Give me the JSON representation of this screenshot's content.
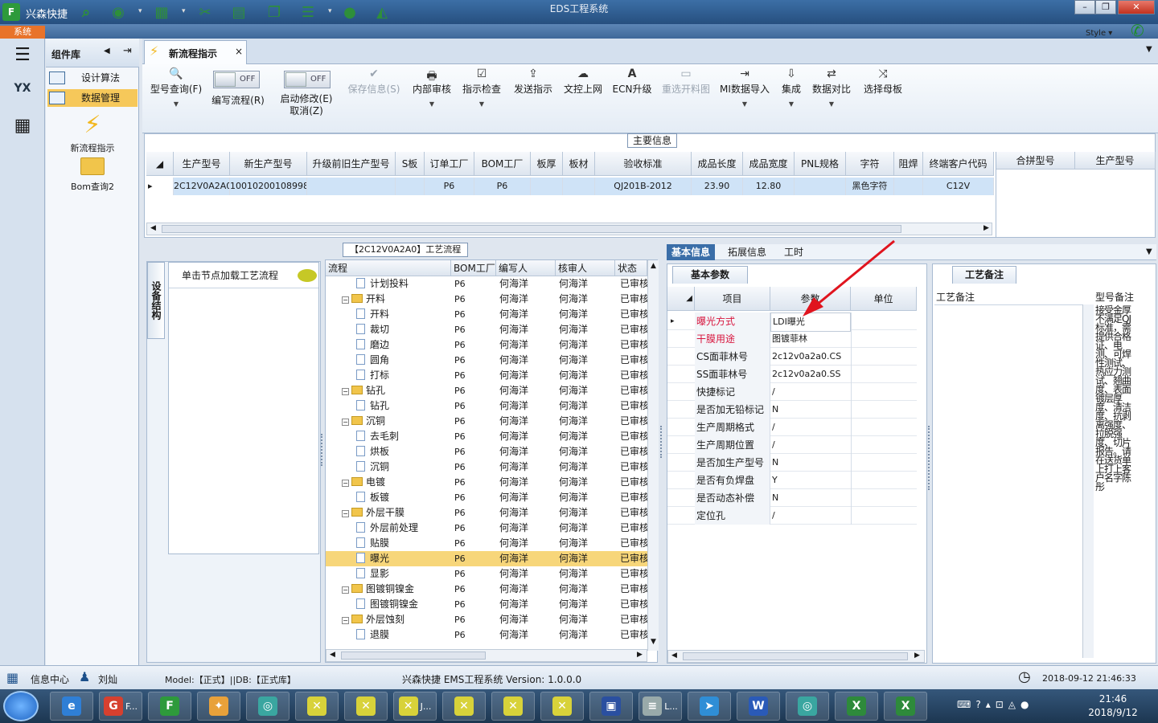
{
  "window": {
    "app_name": "兴森快捷",
    "title": "EDS工程系统",
    "style_label": "Style ▾",
    "system_tab": "系统",
    "controls": [
      "–",
      "❐",
      "✕"
    ]
  },
  "toolbar_icons": [
    "search-icon",
    "compass-icon",
    "grid-icon",
    "scissors-icon",
    "film-icon",
    "clipboard-icon",
    "list-icon",
    "user-icon",
    "mountain-chart-icon"
  ],
  "left_strip": {
    "items": [
      "menu-icon",
      "factory-icon",
      "calculator-icon"
    ]
  },
  "component_library": {
    "title": "组件库",
    "items": [
      {
        "label": "设计算法"
      },
      {
        "label": "数据管理",
        "selected": true
      }
    ],
    "tools": [
      {
        "label": "新流程指示"
      },
      {
        "label": "Bom查询2"
      }
    ]
  },
  "tabs": [
    {
      "label": "新流程指示",
      "close": "×"
    }
  ],
  "ribbon": {
    "buttons": [
      {
        "label": "型号查询(F)",
        "icon": "🔍",
        "disabled": false,
        "dropdown": true
      },
      {
        "label": "编写流程(R)",
        "toggle": "OFF"
      },
      {
        "label": "启动修改(E)",
        "label2": "取消(Z)",
        "toggle": "OFF"
      },
      {
        "label": "保存信息(S)",
        "icon": "✔",
        "disabled": true
      },
      {
        "label": "内部审核",
        "icon": "🖶",
        "dropdown": true
      },
      {
        "label": "指示检查",
        "icon": "☑",
        "dropdown": true
      },
      {
        "label": "发送指示",
        "icon": "⇪"
      },
      {
        "label": "文控上网",
        "icon": "☁"
      },
      {
        "label": "ECN升级",
        "icon": "A"
      },
      {
        "label": "重选开料图",
        "icon": "▭",
        "disabled": true
      },
      {
        "label": "MI数据导入",
        "icon": "⇥",
        "dropdown": true
      },
      {
        "label": "集成",
        "icon": "⇩",
        "dropdown": true
      },
      {
        "label": "数据对比",
        "icon": "⇄",
        "dropdown": true
      },
      {
        "label": "选择母板",
        "icon": "⤨"
      }
    ]
  },
  "main_info": {
    "label": "主要信息",
    "columns": [
      "生产型号",
      "新生产型号",
      "升级前旧生产型号",
      "S板",
      "订单工厂",
      "BOM工厂",
      "板厚",
      "板材",
      "验收标准",
      "成品长度",
      "成品宽度",
      "PNL规格",
      "字符",
      "阻焊",
      "终端客户代码"
    ],
    "row": [
      "2C12V0A2A0",
      "10010200108998",
      "",
      "",
      "P6",
      "P6",
      "",
      "",
      "QJ201B-2012",
      "23.90",
      "12.80",
      "",
      "黑色字符",
      "",
      "C12V"
    ],
    "side_columns": [
      "合拼型号",
      "生产型号"
    ]
  },
  "equipment": {
    "vtab": "设备结构",
    "hint": "单击节点加载工艺流程"
  },
  "flow": {
    "title": "【2C12V0A2A0】工艺流程",
    "columns": [
      "流程",
      "BOM工厂",
      "编写人",
      "核审人",
      "状态"
    ],
    "rows": [
      {
        "name": "计划投料",
        "level": 1,
        "factory": "P6",
        "writer": "何海洋",
        "reviewer": "何海洋",
        "status": "已审核"
      },
      {
        "name": "开料",
        "level": 0,
        "factory": "P6",
        "writer": "何海洋",
        "reviewer": "何海洋",
        "status": "已审核"
      },
      {
        "name": "开料",
        "level": 1,
        "factory": "P6",
        "writer": "何海洋",
        "reviewer": "何海洋",
        "status": "已审核"
      },
      {
        "name": "裁切",
        "level": 1,
        "factory": "P6",
        "writer": "何海洋",
        "reviewer": "何海洋",
        "status": "已审核"
      },
      {
        "name": "磨边",
        "level": 1,
        "factory": "P6",
        "writer": "何海洋",
        "reviewer": "何海洋",
        "status": "已审核"
      },
      {
        "name": "圆角",
        "level": 1,
        "factory": "P6",
        "writer": "何海洋",
        "reviewer": "何海洋",
        "status": "已审核"
      },
      {
        "name": "打标",
        "level": 1,
        "factory": "P6",
        "writer": "何海洋",
        "reviewer": "何海洋",
        "status": "已审核"
      },
      {
        "name": "钻孔",
        "level": 0,
        "factory": "P6",
        "writer": "何海洋",
        "reviewer": "何海洋",
        "status": "已审核"
      },
      {
        "name": "钻孔",
        "level": 1,
        "factory": "P6",
        "writer": "何海洋",
        "reviewer": "何海洋",
        "status": "已审核"
      },
      {
        "name": "沉铜",
        "level": 0,
        "factory": "P6",
        "writer": "何海洋",
        "reviewer": "何海洋",
        "status": "已审核"
      },
      {
        "name": "去毛刺",
        "level": 1,
        "factory": "P6",
        "writer": "何海洋",
        "reviewer": "何海洋",
        "status": "已审核"
      },
      {
        "name": "烘板",
        "level": 1,
        "factory": "P6",
        "writer": "何海洋",
        "reviewer": "何海洋",
        "status": "已审核"
      },
      {
        "name": "沉铜",
        "level": 1,
        "factory": "P6",
        "writer": "何海洋",
        "reviewer": "何海洋",
        "status": "已审核"
      },
      {
        "name": "电镀",
        "level": 0,
        "factory": "P6",
        "writer": "何海洋",
        "reviewer": "何海洋",
        "status": "已审核"
      },
      {
        "name": "板镀",
        "level": 1,
        "factory": "P6",
        "writer": "何海洋",
        "reviewer": "何海洋",
        "status": "已审核"
      },
      {
        "name": "外层干膜",
        "level": 0,
        "factory": "P6",
        "writer": "何海洋",
        "reviewer": "何海洋",
        "status": "已审核"
      },
      {
        "name": "外层前处理",
        "level": 1,
        "factory": "P6",
        "writer": "何海洋",
        "reviewer": "何海洋",
        "status": "已审核"
      },
      {
        "name": "贴膜",
        "level": 1,
        "factory": "P6",
        "writer": "何海洋",
        "reviewer": "何海洋",
        "status": "已审核"
      },
      {
        "name": "曝光",
        "level": 1,
        "factory": "P6",
        "writer": "何海洋",
        "reviewer": "何海洋",
        "status": "已审核",
        "selected": true
      },
      {
        "name": "显影",
        "level": 1,
        "factory": "P6",
        "writer": "何海洋",
        "reviewer": "何海洋",
        "status": "已审核"
      },
      {
        "name": "图镀铜镍金",
        "level": 0,
        "factory": "P6",
        "writer": "何海洋",
        "reviewer": "何海洋",
        "status": "已审核"
      },
      {
        "name": "图镀铜镍金",
        "level": 1,
        "factory": "P6",
        "writer": "何海洋",
        "reviewer": "何海洋",
        "status": "已审核"
      },
      {
        "name": "外层蚀刻",
        "level": 0,
        "factory": "P6",
        "writer": "何海洋",
        "reviewer": "何海洋",
        "status": "已审核"
      },
      {
        "name": "退膜",
        "level": 1,
        "factory": "P6",
        "writer": "何海洋",
        "reviewer": "何海洋",
        "status": "已审核"
      }
    ]
  },
  "basic_info_tabs": [
    {
      "label": "基本信息",
      "active": true
    },
    {
      "label": "拓展信息"
    },
    {
      "label": "工时"
    }
  ],
  "basic_params": {
    "tab": "基本参数",
    "columns": [
      "项目",
      "参数",
      "单位"
    ],
    "rows": [
      {
        "key": "曝光方式",
        "value": "LDI曝光",
        "red": true,
        "selected": true
      },
      {
        "key": "干膜用途",
        "value": "图镀菲林",
        "red": true
      },
      {
        "key": "CS面菲林号",
        "value": "2c12v0a2a0.CS"
      },
      {
        "key": "SS面菲林号",
        "value": "2c12v0a2a0.SS"
      },
      {
        "key": "快捷标记",
        "value": "/"
      },
      {
        "key": "是否加无铅标记",
        "value": "N"
      },
      {
        "key": "生产周期格式",
        "value": "/"
      },
      {
        "key": "生产周期位置",
        "value": "/"
      },
      {
        "key": "是否加生产型号",
        "value": "N"
      },
      {
        "key": "是否有负焊盘",
        "value": "Y"
      },
      {
        "key": "是否动态补偿",
        "value": "N"
      },
      {
        "key": "定位孔",
        "value": "/"
      }
    ]
  },
  "process_note": {
    "tab": "工艺备注",
    "col1": "工艺备注",
    "col2": "型号备注",
    "text": "接受金厚不满足QJ标准，需提供合格证、电测、可焊性测试、热应力测试、翘曲度、表面镀层厚度、清洁度、抗剥离强度、拉脱强度、切片报告。请在送货单上打上客户名字陈彤"
  },
  "status_bar": {
    "info": "信息中心",
    "user": "刘灿",
    "model": "Model:【正式】||DB:【正式库】",
    "version": "兴森快捷 EMS工程系统 Version: 1.0.0.0",
    "datetime": "2018-09-12 21:46:33"
  },
  "taskbar": {
    "time": "21:46",
    "date": "2018/9/12",
    "items": [
      {
        "icon": "ie-icon",
        "label": ""
      },
      {
        "icon": "app-g-icon",
        "label": "F..."
      },
      {
        "icon": "app-f-icon",
        "label": ""
      },
      {
        "icon": "shell-icon",
        "label": ""
      },
      {
        "icon": "disc-icon",
        "label": ""
      },
      {
        "icon": "xmind-icon",
        "label": ""
      },
      {
        "icon": "xmind-icon",
        "label": ""
      },
      {
        "icon": "xmind-icon",
        "label": "J..."
      },
      {
        "icon": "xmind-icon",
        "label": ""
      },
      {
        "icon": "xmind-icon",
        "label": ""
      },
      {
        "icon": "xmind-icon",
        "label": ""
      },
      {
        "icon": "save-icon",
        "label": ""
      },
      {
        "icon": "doc-icon",
        "label": "L..."
      },
      {
        "icon": "bird-icon",
        "label": ""
      },
      {
        "icon": "word-icon",
        "label": ""
      },
      {
        "icon": "disc-icon",
        "label": ""
      },
      {
        "icon": "excel-icon",
        "label": ""
      },
      {
        "icon": "excel-icon",
        "label": ""
      }
    ]
  }
}
